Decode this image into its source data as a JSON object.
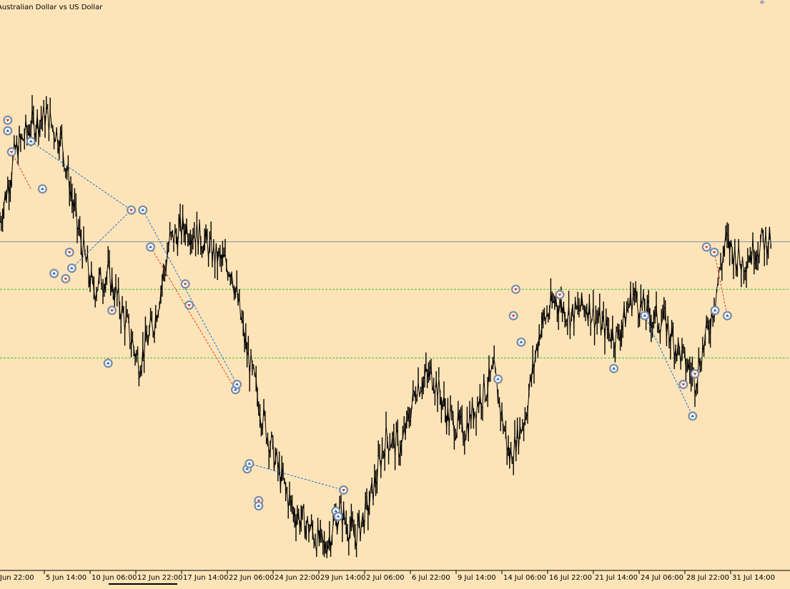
{
  "window": {
    "title": "Australian Dollar vs US Dollar"
  },
  "colors": {
    "background": "#fde4b8",
    "candles": "#000000",
    "bull_candle_accent": "#00a000",
    "horizontal_line": "#7d8ca3",
    "level_lines": "#3cbf3c",
    "trade_buy": "#1f6fcf",
    "trade_sell": "#e03a1a",
    "trade_marker_ring": "#7d8ca3"
  },
  "chart_data": {
    "type": "line",
    "title": "Australian Dollar vs US Dollar",
    "xlabel": "",
    "ylabel": "",
    "grid": false,
    "x_tick_labels": [
      "Jun 22:00",
      "5 Jun 14:00",
      "10 Jun 06:00",
      "12 Jun 22:00",
      "17 Jun 14:00",
      "22 Jun 06:00",
      "24 Jun 22:00",
      "29 Jun 14:00",
      "2 Jul 06:00",
      "6 Jul 22:00",
      "9 Jul 14:00",
      "14 Jul 06:00",
      "16 Jul 22:00",
      "21 Jul 14:00",
      "24 Jul 06:00",
      "28 Jul 22:00",
      "31 Jul 14:00"
    ],
    "x": [
      0,
      2,
      4,
      6,
      8,
      10,
      12,
      14,
      16,
      18,
      20,
      22,
      24,
      26,
      28,
      30,
      32,
      34,
      36,
      38,
      40,
      42,
      44,
      46,
      48,
      50,
      52,
      54,
      56,
      58,
      60,
      62,
      64,
      66,
      68,
      70,
      72,
      74,
      76,
      78,
      80,
      82,
      84,
      86,
      88,
      90,
      92,
      94,
      96,
      98,
      100
    ],
    "price_close": [
      65,
      78,
      83,
      85,
      80,
      64,
      52,
      55,
      47,
      38,
      46,
      61,
      64,
      62,
      58,
      56,
      40,
      28,
      18,
      10,
      7,
      3,
      10,
      5,
      12,
      24,
      22,
      34,
      36,
      28,
      25,
      31,
      36,
      20,
      28,
      45,
      50,
      47,
      49,
      45,
      43,
      51,
      47,
      46,
      40,
      35,
      46,
      61,
      57,
      60,
      62
    ],
    "y_range": [
      0,
      100
    ],
    "levels": {
      "solid": 61,
      "dashed": [
        52,
        39
      ]
    },
    "trades": [
      {
        "side": "buy",
        "x": 1,
        "y": 82
      },
      {
        "side": "sell",
        "x": 1,
        "y": 84
      },
      {
        "side": "sell",
        "x": 1.5,
        "y": 78
      },
      {
        "side": "buy",
        "x": 4,
        "y": 80
      },
      {
        "side": "buy",
        "x": 5.5,
        "y": 71
      },
      {
        "side": "sell",
        "x": 9,
        "y": 59
      },
      {
        "side": "buy",
        "x": 7,
        "y": 55
      },
      {
        "side": "sell",
        "x": 8.5,
        "y": 54
      },
      {
        "side": "buy",
        "x": 9.3,
        "y": 56
      },
      {
        "side": "sell",
        "x": 14.5,
        "y": 48
      },
      {
        "side": "buy",
        "x": 14,
        "y": 38
      },
      {
        "side": "sell",
        "x": 17,
        "y": 67
      },
      {
        "side": "buy",
        "x": 18.5,
        "y": 67
      },
      {
        "side": "buy",
        "x": 19.5,
        "y": 60
      },
      {
        "side": "sell",
        "x": 24,
        "y": 53
      },
      {
        "side": "sell",
        "x": 24.5,
        "y": 49
      },
      {
        "side": "buy",
        "x": 30.5,
        "y": 33
      },
      {
        "side": "buy",
        "x": 30.7,
        "y": 34
      },
      {
        "side": "buy",
        "x": 32,
        "y": 18
      },
      {
        "side": "buy",
        "x": 32.3,
        "y": 19
      },
      {
        "side": "sell",
        "x": 33.5,
        "y": 12
      },
      {
        "side": "buy",
        "x": 33.5,
        "y": 11
      },
      {
        "side": "buy",
        "x": 43.5,
        "y": 10
      },
      {
        "side": "buy",
        "x": 43.8,
        "y": 9
      },
      {
        "side": "sell",
        "x": 44.5,
        "y": 14
      },
      {
        "side": "buy",
        "x": 64.5,
        "y": 35
      },
      {
        "side": "sell",
        "x": 66.5,
        "y": 47
      },
      {
        "side": "sell",
        "x": 66.8,
        "y": 52
      },
      {
        "side": "buy",
        "x": 67.5,
        "y": 42
      },
      {
        "side": "sell",
        "x": 72.5,
        "y": 51
      },
      {
        "side": "buy",
        "x": 79.5,
        "y": 37
      },
      {
        "side": "buy",
        "x": 83.5,
        "y": 47
      },
      {
        "side": "sell",
        "x": 88.5,
        "y": 34
      },
      {
        "side": "sell",
        "x": 90,
        "y": 36
      },
      {
        "side": "buy",
        "x": 89.7,
        "y": 28
      },
      {
        "side": "sell",
        "x": 91.5,
        "y": 60
      },
      {
        "side": "sell",
        "x": 92.5,
        "y": 59
      },
      {
        "side": "buy",
        "x": 92.6,
        "y": 48
      },
      {
        "side": "buy",
        "x": 94.2,
        "y": 47
      }
    ],
    "trade_links": [
      {
        "color": "buy",
        "from": [
          4,
          80
        ],
        "to": [
          17,
          67
        ]
      },
      {
        "color": "buy",
        "from": [
          9.3,
          56
        ],
        "to": [
          17,
          67
        ]
      },
      {
        "color": "buy",
        "from": [
          18.5,
          67
        ],
        "to": [
          30.7,
          34
        ]
      },
      {
        "color": "sell",
        "from": [
          19.5,
          60
        ],
        "to": [
          30.5,
          33
        ]
      },
      {
        "color": "buy",
        "from": [
          32.3,
          19
        ],
        "to": [
          44.5,
          14
        ]
      },
      {
        "color": "buy",
        "from": [
          83.5,
          47
        ],
        "to": [
          89.7,
          28
        ]
      },
      {
        "color": "sell",
        "from": [
          92.5,
          59
        ],
        "to": [
          94.2,
          47
        ]
      },
      {
        "color": "sell",
        "from": [
          1.5,
          78
        ],
        "to": [
          4,
          71
        ]
      }
    ]
  }
}
